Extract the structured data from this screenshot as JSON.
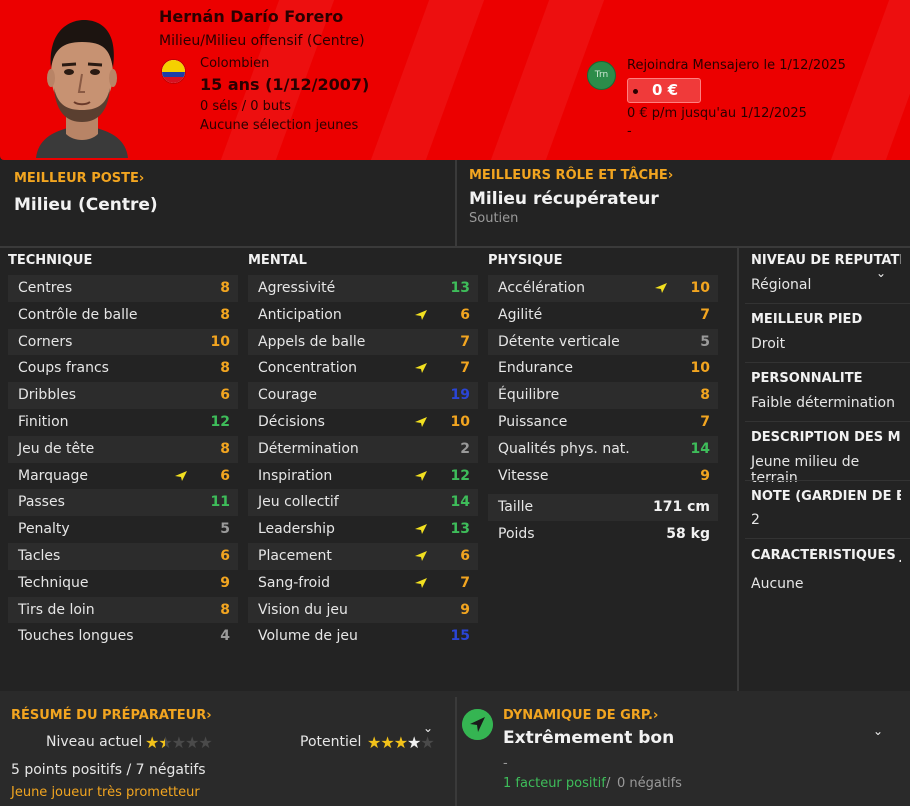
{
  "player": {
    "name": "Hernán Darío Forero",
    "positions": "Milieu/Milieu offensif (Centre)",
    "nationality": "Colombien",
    "age": "15 ans (1/12/2007)",
    "caps": "0 séls / 0 buts",
    "youth_caps": "Aucune sélection jeunes"
  },
  "contract": {
    "club_badge": "Trn",
    "transfer_text": "Rejoindra Mensajero le 1/12/2025",
    "fee": "0 €",
    "wage": "0 € p/m jusqu'au 1/12/2025",
    "dash": "-"
  },
  "best_position": {
    "title": "MEILLEUR POSTE",
    "value": "Milieu (Centre)"
  },
  "best_role": {
    "title": "MEILLEURS RÔLE ET TÂCHE",
    "value": "Milieu récupérateur",
    "duty": "Soutien"
  },
  "columns": {
    "technique": "TECHNIQUE",
    "mental": "MENTAL",
    "physique": "PHYSIQUE"
  },
  "technique": [
    {
      "label": "Centres",
      "value": "8"
    },
    {
      "label": "Contrôle de balle",
      "value": "8"
    },
    {
      "label": "Corners",
      "value": "10"
    },
    {
      "label": "Coups francs",
      "value": "8"
    },
    {
      "label": "Dribbles",
      "value": "6"
    },
    {
      "label": "Finition",
      "value": "12"
    },
    {
      "label": "Jeu de tête",
      "value": "8"
    },
    {
      "label": "Marquage",
      "value": "6"
    },
    {
      "label": "Passes",
      "value": "11"
    },
    {
      "label": "Penalty",
      "value": "5"
    },
    {
      "label": "Tacles",
      "value": "6"
    },
    {
      "label": "Technique",
      "value": "9"
    },
    {
      "label": "Tirs de loin",
      "value": "8"
    },
    {
      "label": "Touches longues",
      "value": "4"
    }
  ],
  "mental": [
    {
      "label": "Agressivité",
      "value": "13"
    },
    {
      "label": "Anticipation",
      "value": "6"
    },
    {
      "label": "Appels de balle",
      "value": "7"
    },
    {
      "label": "Concentration",
      "value": "7"
    },
    {
      "label": "Courage",
      "value": "19"
    },
    {
      "label": "Décisions",
      "value": "10"
    },
    {
      "label": "Détermination",
      "value": "2"
    },
    {
      "label": "Inspiration",
      "value": "12"
    },
    {
      "label": "Jeu collectif",
      "value": "14"
    },
    {
      "label": "Leadership",
      "value": "13"
    },
    {
      "label": "Placement",
      "value": "6"
    },
    {
      "label": "Sang-froid",
      "value": "7"
    },
    {
      "label": "Vision du jeu",
      "value": "9"
    },
    {
      "label": "Volume de jeu",
      "value": "15"
    }
  ],
  "physique": [
    {
      "label": "Accélération",
      "value": "10"
    },
    {
      "label": "Agilité",
      "value": "7"
    },
    {
      "label": "Détente verticale",
      "value": "5"
    },
    {
      "label": "Endurance",
      "value": "10"
    },
    {
      "label": "Équilibre",
      "value": "8"
    },
    {
      "label": "Puissance",
      "value": "7"
    },
    {
      "label": "Qualités phys. nat.",
      "value": "14"
    },
    {
      "label": "Vitesse",
      "value": "9"
    },
    {
      "label": "Taille",
      "value": "171 cm"
    },
    {
      "label": "Poids",
      "value": "58 kg"
    }
  ],
  "sidebar": {
    "reputation_title": "NIVEAU DE RÉPUTATION",
    "reputation_value": "Régional",
    "foot_title": "MEILLEUR PIED",
    "foot_value": "Droit",
    "personality_title": "PERSONNALITÉ",
    "personality_value": "Faible détermination",
    "description_title": "DESCRIPTION DES MÉDIAS",
    "description_value": "Jeune milieu de terrain",
    "gk_title": "NOTE (GARDIEN DE BUT)",
    "gk_value": "2",
    "traits_title": "CARACTÉRISTIQUES JOUEUR",
    "traits_value": "Aucune"
  },
  "coach": {
    "title": "RÉSUMÉ DU PRÉPARATEUR",
    "current_label": "Niveau actuel",
    "current_stars": 1.5,
    "potential_label": "Potentiel",
    "potential_stars": 3.5,
    "points": "5 points positifs / 7 négatifs",
    "note": "Jeune joueur très prometteur"
  },
  "dynamics": {
    "title": "DYNAMIQUE DE GRP.",
    "value": "Extrêmement bon",
    "dash": "-",
    "positive": "1 facteur positif",
    "separator": "/",
    "negative": "0 négatifs"
  },
  "colors": {
    "header": "#ec0000",
    "accent": "#f2a520",
    "good": "#3ebd5a",
    "excellent": "#2a45d6",
    "poor": "#9a9a9a"
  },
  "icons": {
    "arrow": "improving-arrow-icon",
    "chevron": "chevron-down-icon",
    "dynamics": "navigation-arrow-icon"
  }
}
